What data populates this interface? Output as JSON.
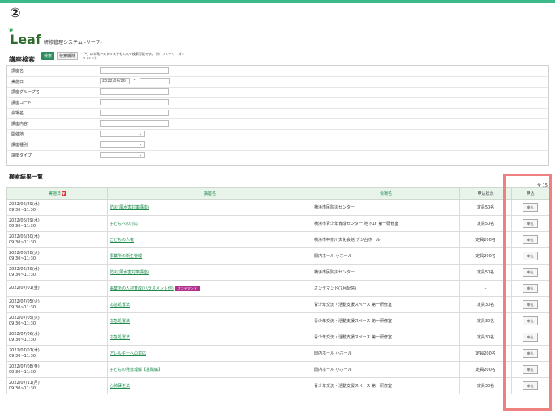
{
  "step_marker": "②",
  "app": {
    "logo": "Leaf",
    "subtitle": "研修管理システム -リーフ-"
  },
  "search": {
    "title": "講座検索",
    "search_button": "検索",
    "clear_button": "検索解除",
    "hint": "「*」は半角アスタリスクを入れて検索可能です。 例：インソリーズ＊ペイン＊)",
    "fields": [
      {
        "label": "講座名",
        "type": "input",
        "value": ""
      },
      {
        "label": "実施日",
        "type": "daterange",
        "value": "2022/06/26",
        "value2": ""
      },
      {
        "label": "講座グループ名",
        "type": "input",
        "value": ""
      },
      {
        "label": "講座コード",
        "type": "input",
        "value": ""
      },
      {
        "label": "会場名",
        "type": "input",
        "value": ""
      },
      {
        "label": "講座内容",
        "type": "input",
        "value": ""
      },
      {
        "label": "開催地",
        "type": "select",
        "value": ""
      },
      {
        "label": "講座種別",
        "type": "select",
        "value": ""
      },
      {
        "label": "講座タイプ",
        "type": "select",
        "value": ""
      }
    ]
  },
  "results": {
    "title": "検索結果一覧",
    "count": "全 15",
    "headers": {
      "date": "実施日",
      "course": "講座名",
      "venue": "会場名",
      "status": "申込状況",
      "apply": "申込"
    },
    "sort_icon": "▼",
    "apply_label": "申込",
    "ondemand_label": "オンデマンド",
    "rows": [
      {
        "date": "2022/06/29(水)",
        "time": "09:30~11:30",
        "course": "防災(風水害対策講座)",
        "venue": "横浜市民防災センター",
        "status": "定員50名",
        "ondemand": false
      },
      {
        "date": "2022/06/29(水)",
        "time": "09:30~11:30",
        "course": "子どもへの対応",
        "venue": "横浜市青少年育成センター 地下1F 第一研修室",
        "status": "定員50名",
        "ondemand": false
      },
      {
        "date": "2022/06/30(木)",
        "time": "09:30~11:30",
        "course": "こどもの人権",
        "venue": "横浜市神奈川文化会館 デジ台ホール",
        "status": "定員200名",
        "ondemand": false
      },
      {
        "date": "2022/06/28(火)",
        "time": "09:30~11:30",
        "course": "事業所の衛生管理",
        "venue": "関内ホール 小ホール",
        "status": "定員200名",
        "ondemand": false
      },
      {
        "date": "2022/06/29(水)",
        "time": "09:30~11:30",
        "course": "防災(風水害対策講座)",
        "venue": "横浜市民防災センター",
        "status": "定員50名",
        "ondemand": false
      },
      {
        "date": "2022/07/01(金)",
        "time": "",
        "course": "事業所の人材育成(ハラスメント他)",
        "venue": "オンデマンド(7月配信)",
        "status": "-",
        "ondemand": true
      },
      {
        "date": "2022/07/05(火)",
        "time": "09:30~11:30",
        "course": "応急処置法",
        "venue": "青少年交流・活動支援スペース 第一研修室",
        "status": "定員30名",
        "ondemand": false
      },
      {
        "date": "2022/07/05(火)",
        "time": "09:30~11:30",
        "course": "応急処置法",
        "venue": "青少年交流・活動支援スペース 第一研修室",
        "status": "定員30名",
        "ondemand": false
      },
      {
        "date": "2022/07/06(水)",
        "time": "09:30~11:30",
        "course": "応急処置法",
        "venue": "青少年交流・活動支援スペース 第一研修室",
        "status": "定員30名",
        "ondemand": false
      },
      {
        "date": "2022/07/07(木)",
        "time": "09:30~11:30",
        "course": "アレルギーへの対応",
        "venue": "関内ホール 小ホール",
        "status": "定員200名",
        "ondemand": false
      },
      {
        "date": "2022/07/08(金)",
        "time": "09:30~11:30",
        "course": "子どもの発達理解【基礎編】",
        "venue": "関内ホール 小ホール",
        "status": "定員200名",
        "ondemand": false
      },
      {
        "date": "2022/07/11(月)",
        "time": "09:30~11:30",
        "course": "心肺蘇生法",
        "venue": "青少年交流・活動支援スペース 第一研修室",
        "status": "定員30名",
        "ondemand": false
      }
    ]
  },
  "colors": {
    "accent": "#3cba8c",
    "link": "#1e8a4c",
    "highlight": "#ee8080",
    "ondemand": "#b0328f"
  }
}
